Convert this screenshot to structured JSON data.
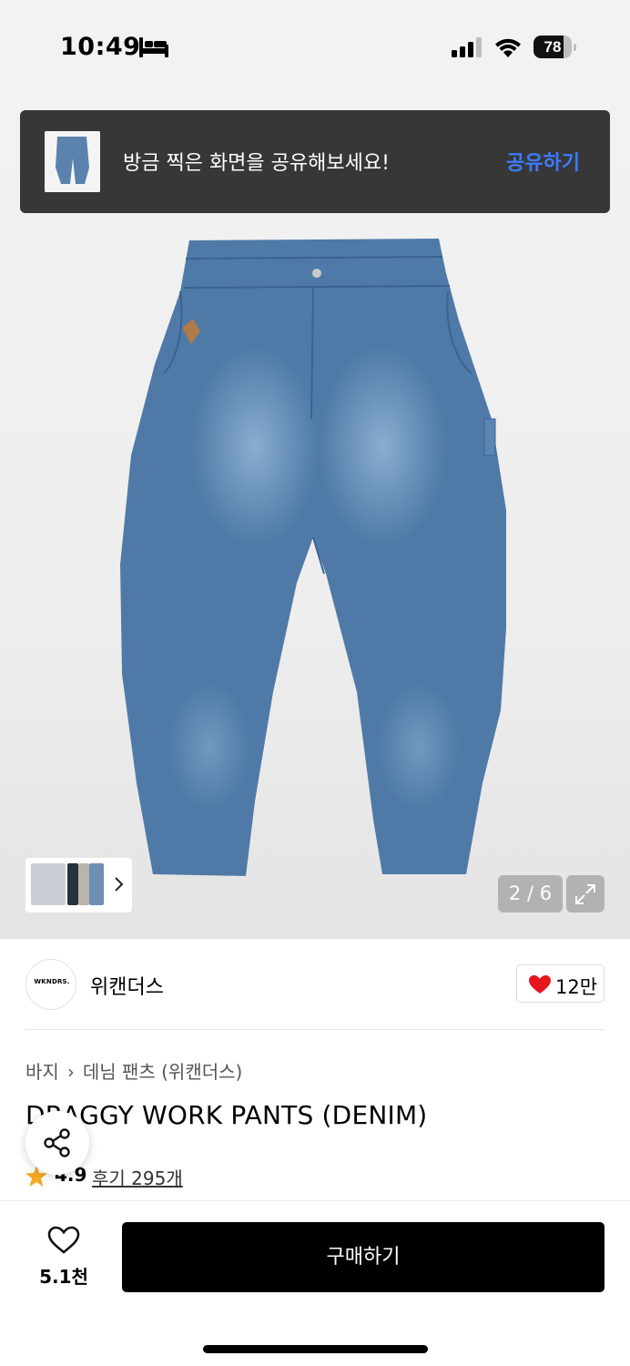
{
  "status_bar": {
    "time": "10:49",
    "battery": "78",
    "battery_level": 0.78
  },
  "toast": {
    "message": "방금 찍은 화면을 공유해보세요!",
    "action": "공유하기"
  },
  "gallery": {
    "pager": "2 / 6",
    "icons": [
      "chevron-right-icon",
      "expand-icon"
    ]
  },
  "brand": {
    "logo_text": "WKNDRS.",
    "name": "위캔더스",
    "likes": "12만"
  },
  "breadcrumb": {
    "category": "바지",
    "subcategory": "데님 팬츠 (위캔더스)"
  },
  "product": {
    "title": "DRAGGY WORK PANTS (DENIM)",
    "rating": "4.9",
    "reviews": "후기 295개"
  },
  "bottom_bar": {
    "wish_count": "5.1천",
    "buy_label": "구매하기"
  },
  "colors": {
    "accent_link": "#3d7bff",
    "heart": "#e5161c",
    "star": "#f5a623",
    "toast_bg": "#373737"
  }
}
